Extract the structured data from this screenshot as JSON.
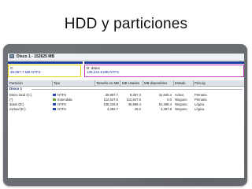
{
  "slide": {
    "title": "HDD y particiones"
  },
  "disk": {
    "title": "Disco 1 - 152625 MB",
    "partitions": [
      {
        "name": "C:",
        "size_fs": "39,997.7 MB    NTFS",
        "color": "#e8d100"
      },
      {
        "name": "D:   datos",
        "size_fs": "108,234.8 MB    NTFS",
        "color": "#c23cc2"
      }
    ]
  },
  "table": {
    "columns": [
      "Partición",
      "Tipo",
      "Tamaño en MB",
      "MB Usados",
      "MB disponibles",
      "Estado",
      "Pri/Lóg"
    ],
    "group_label": "Disco 1",
    "rows": [
      {
        "particion": "Disco local (C:)",
        "tipo": "NTFS",
        "tamano": "39,997.7",
        "usados": "8,357.4",
        "disponibles": "31,640.4",
        "estado": "Activo",
        "prilog": "Primaria"
      },
      {
        "particion": "(*)",
        "tipo": "Extendida",
        "tamano": "112,627.6",
        "usados": "112,627.6",
        "disponibles": "0.0",
        "estado": "Ninguno",
        "prilog": "Primaria"
      },
      {
        "particion": "datos (D:)",
        "tipo": "NTFS",
        "tamano": "108,234.8",
        "usados": "46,866.4",
        "disponibles": "61,368.4",
        "estado": "Ninguno",
        "prilog": "Lógica"
      },
      {
        "particion": "nvrtual (E:)",
        "tipo": "NTFS",
        "tamano": "4,392.7",
        "usados": "25.0",
        "disponibles": "4,367.8",
        "estado": "Ninguno",
        "prilog": "Lógica"
      }
    ]
  },
  "colors": {
    "frame": "#6a6d72",
    "accent_blue": "#1a3d9b",
    "partition_c": "#e8d100",
    "partition_d": "#c23cc2"
  }
}
